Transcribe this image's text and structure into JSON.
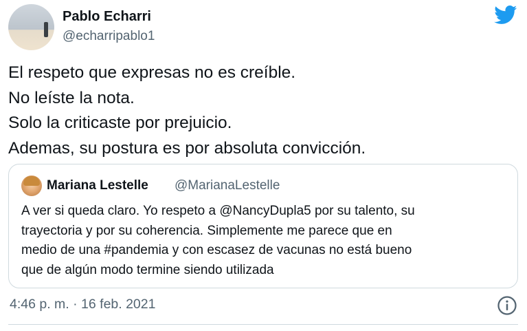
{
  "author": {
    "name": "Pablo Echarri",
    "handle": "@echarripablo1"
  },
  "tweet": {
    "lines": [
      "El respeto que expresas no es creíble.",
      "No leíste la nota.",
      "Solo la criticaste por prejuicio.",
      "Ademas, su postura es por absoluta convicción."
    ]
  },
  "quote": {
    "name": "Mariana Lestelle",
    "handle": "@MarianaLestelle",
    "lines": [
      "A ver si queda claro. Yo respeto a @NancyDupla5 por su talento, su",
      "trayectoria y por su coherencia. Simplemente me parece que en",
      "medio de una #pandemia y con escasez de vacunas no está bueno",
      "que de algún modo termine siendo utilizada"
    ]
  },
  "meta": {
    "timestamp": "4:46 p. m. · 16 feb. 2021"
  },
  "icons": {
    "brand": "twitter-bird-icon",
    "info": "info-icon"
  },
  "colors": {
    "brand": "#1d9bf0",
    "secondary_text": "#536471",
    "border": "#cfd9de"
  }
}
